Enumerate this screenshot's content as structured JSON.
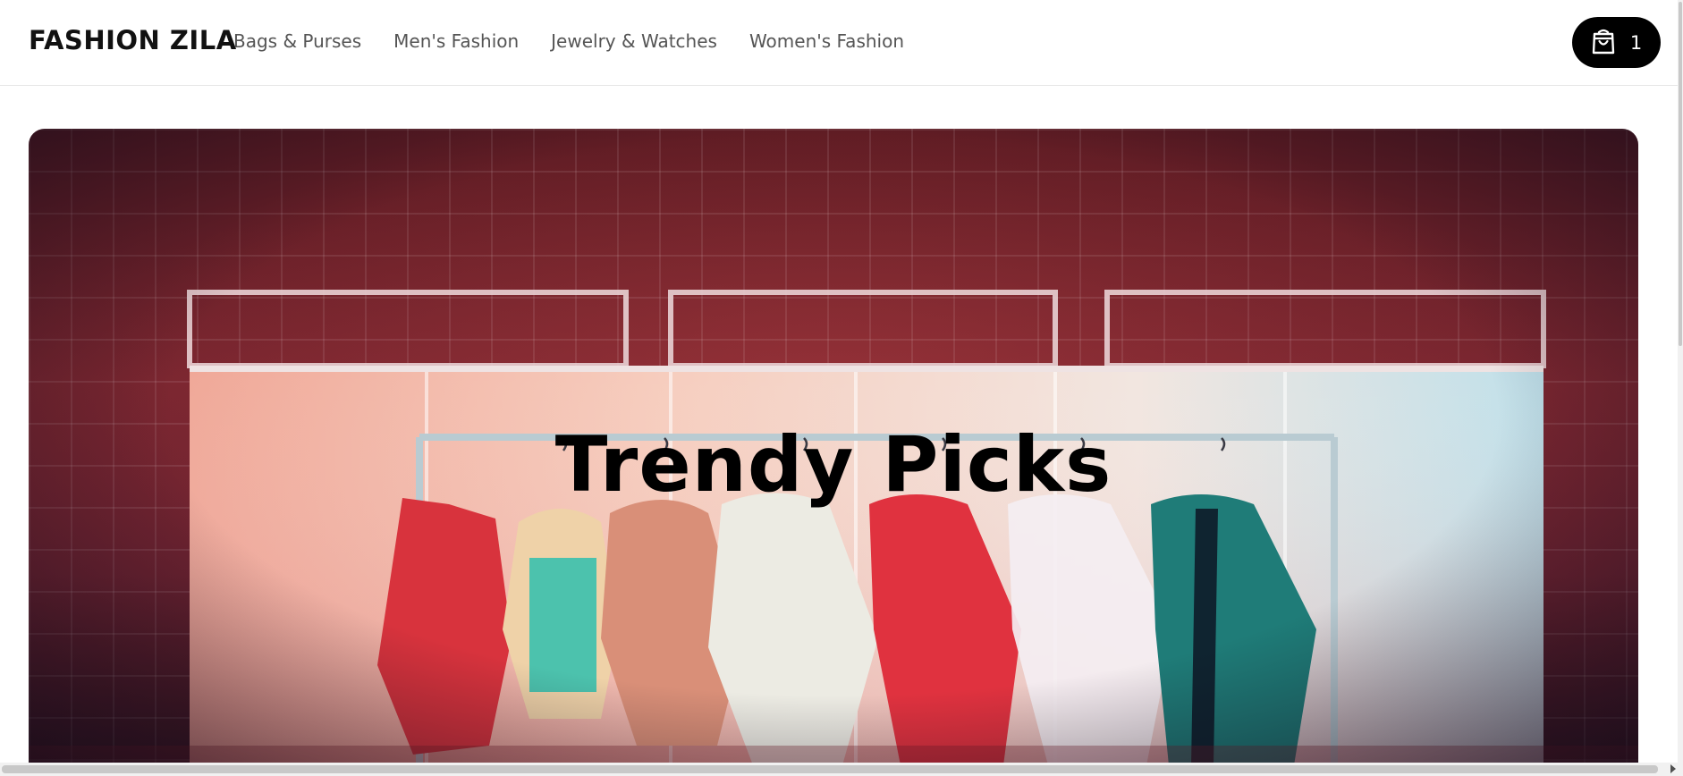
{
  "header": {
    "brand": "FASHION ZILA",
    "nav": [
      "Bags & Purses",
      "Men's Fashion",
      "Jewelry & Watches",
      "Women's Fashion"
    ],
    "cart": {
      "icon": "shopping-bag-icon",
      "count": "1"
    }
  },
  "hero": {
    "title": "Trendy Picks",
    "image": "clothing-rack-photo"
  },
  "colors": {
    "cart_bg": "#000000",
    "hero_wall": "#7a2630",
    "nav_text": "#555555",
    "brand_text": "#111111"
  }
}
